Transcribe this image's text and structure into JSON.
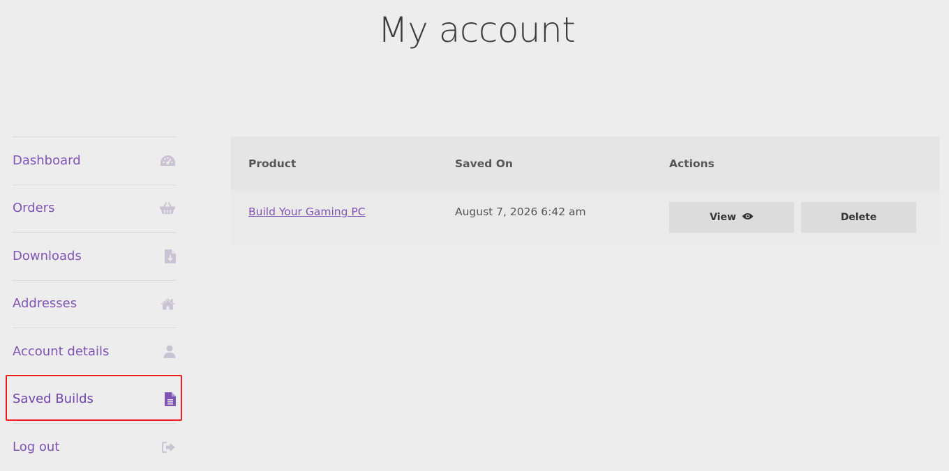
{
  "page": {
    "title": "My account"
  },
  "nav": {
    "items": [
      {
        "label": "Dashboard",
        "icon": "dashboard-gauge-icon"
      },
      {
        "label": "Orders",
        "icon": "basket-icon"
      },
      {
        "label": "Downloads",
        "icon": "file-download-icon"
      },
      {
        "label": "Addresses",
        "icon": "home-icon"
      },
      {
        "label": "Account details",
        "icon": "user-icon"
      },
      {
        "label": "Saved Builds",
        "icon": "document-icon",
        "active": true
      },
      {
        "label": "Log out",
        "icon": "sign-out-icon"
      }
    ]
  },
  "table": {
    "headers": [
      "Product",
      "Saved On",
      "Actions"
    ],
    "rows": [
      {
        "product": "Build Your Gaming PC",
        "saved_on": "August 7, 2026 6:42 am",
        "view_label": "View",
        "delete_label": "Delete"
      }
    ]
  },
  "colors": {
    "accent": "#7f54b3",
    "icon_muted": "#c9c3d3",
    "highlight": "#ee1c1c",
    "background": "#ededed"
  }
}
